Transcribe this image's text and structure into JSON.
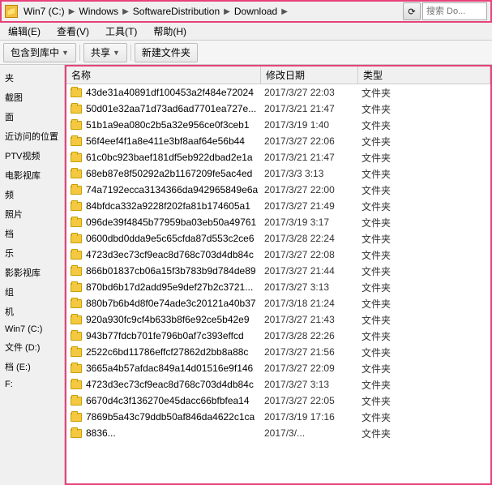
{
  "addressBar": {
    "icon": "📁",
    "breadcrumbs": [
      "Win7 (C:)",
      "Windows",
      "SoftwareDistribution",
      "Download"
    ],
    "refreshBtn": "⟳",
    "searchPlaceholder": "搜索 Do..."
  },
  "menuBar": {
    "items": [
      "编辑(E)",
      "查看(V)",
      "工具(T)",
      "帮助(H)"
    ]
  },
  "toolbar": {
    "includeLib": "包含到库中",
    "share": "共享",
    "newFolder": "新建文件夹"
  },
  "sidebar": {
    "items": [
      "夹",
      "截图",
      "面",
      "近访问的位置",
      "PTV视频",
      "电影视库",
      "频",
      "照片",
      "档",
      "乐",
      "影影视库",
      "组",
      "机",
      "Win7 (C:)",
      "文件 (D:)",
      "档 (E:)",
      "F:"
    ]
  },
  "columns": {
    "name": "名称",
    "date": "修改日期",
    "type": "类型"
  },
  "files": [
    {
      "name": "43de31a40891df100453a2f484e72024",
      "date": "2017/3/27 22:03",
      "type": "文件夹"
    },
    {
      "name": "50d01e32aa71d73ad6ad7701ea727e...",
      "date": "2017/3/21 21:47",
      "type": "文件夹"
    },
    {
      "name": "51b1a9ea080c2b5a32e956ce0f3ceb1",
      "date": "2017/3/19 1:40",
      "type": "文件夹"
    },
    {
      "name": "56f4eef4f1a8e411e3bf8aaf64e56b44",
      "date": "2017/3/27 22:06",
      "type": "文件夹"
    },
    {
      "name": "61c0bc923baef181df5eb922dbad2e1a",
      "date": "2017/3/21 21:47",
      "type": "文件夹"
    },
    {
      "name": "68eb87e8f50292a2b1167209fe5ac4ed",
      "date": "2017/3/3 3:13",
      "type": "文件夹"
    },
    {
      "name": "74a7192ecca3134366da942965849e6a",
      "date": "2017/3/27 22:00",
      "type": "文件夹"
    },
    {
      "name": "84bfdca332a9228f202fa81b174605a1",
      "date": "2017/3/27 21:49",
      "type": "文件夹"
    },
    {
      "name": "096de39f4845b77959ba03eb50a49761",
      "date": "2017/3/19 3:17",
      "type": "文件夹"
    },
    {
      "name": "0600dbd0dda9e5c65cfda87d553c2ce6",
      "date": "2017/3/28 22:24",
      "type": "文件夹"
    },
    {
      "name": "4723d3ec73cf9eac8d768c703d4db84c",
      "date": "2017/3/27 22:08",
      "type": "文件夹"
    },
    {
      "name": "866b01837cb06a15f3b783b9d784de89",
      "date": "2017/3/27 21:44",
      "type": "文件夹"
    },
    {
      "name": "870bd6b17d2add95e9def27b2c3721...",
      "date": "2017/3/27 3:13",
      "type": "文件夹"
    },
    {
      "name": "880b7b6b4d8f0e74ade3c20121a40b37",
      "date": "2017/3/18 21:24",
      "type": "文件夹"
    },
    {
      "name": "920a930fc9cf4b633b8f6e92ce5b42e9",
      "date": "2017/3/27 21:43",
      "type": "文件夹"
    },
    {
      "name": "943b77fdcb701fe796b0af7c393effcd",
      "date": "2017/3/28 22:26",
      "type": "文件夹"
    },
    {
      "name": "2522c6bd11786effcf27862d2bb8a88c",
      "date": "2017/3/27 21:56",
      "type": "文件夹"
    },
    {
      "name": "3665a4b57afdac849a14d01516e9f146",
      "date": "2017/3/27 22:09",
      "type": "文件夹"
    },
    {
      "name": "4723d3ec73cf9eac8d768c703d4db84c",
      "date": "2017/3/27 3:13",
      "type": "文件夹"
    },
    {
      "name": "6670d4c3f136270e45dacc66bfbfea14",
      "date": "2017/3/27 22:05",
      "type": "文件夹"
    },
    {
      "name": "7869b5a43c79ddb50af846da4622c1ca",
      "date": "2017/3/19 17:16",
      "type": "文件夹"
    },
    {
      "name": "8836...",
      "date": "2017/3/...",
      "type": "文件夹"
    }
  ]
}
